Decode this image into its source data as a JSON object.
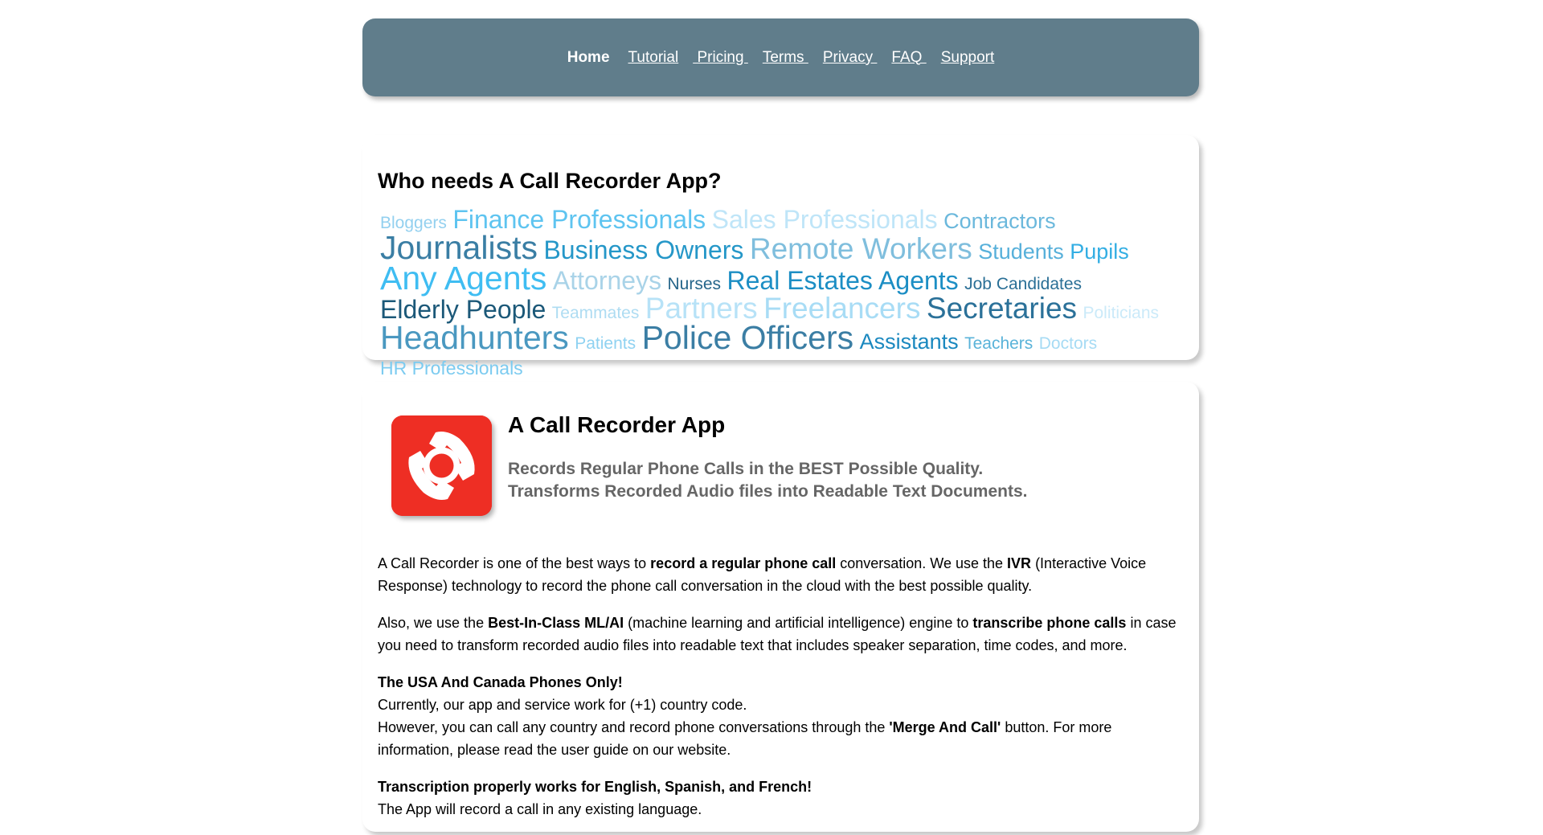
{
  "nav": {
    "items": [
      {
        "label": "Home",
        "active": true
      },
      {
        "label": "Tutorial",
        "active": false
      },
      {
        "label": " Pricing ",
        "active": false
      },
      {
        "label": "Terms ",
        "active": false
      },
      {
        "label": "Privacy ",
        "active": false
      },
      {
        "label": "FAQ ",
        "active": false
      },
      {
        "label": "Support",
        "active": false
      }
    ]
  },
  "who_needs": {
    "title": "Who needs A Call Recorder App?",
    "words": [
      {
        "text": "Bloggers",
        "size": "sm",
        "color": "#93d0ef"
      },
      {
        "text": "Finance Professionals",
        "size": "lg",
        "color": "#5ec4f0"
      },
      {
        "text": "Sales Professionals",
        "size": "lg",
        "color": "#bfe5f8"
      },
      {
        "text": "Contractors",
        "size": "md",
        "color": "#6bb8dc"
      },
      {
        "text": "Journalists",
        "size": "xxl",
        "color": "#3a7ea4"
      },
      {
        "text": "Business Owners",
        "size": "lg",
        "color": "#2597c8"
      },
      {
        "text": "Remote Workers",
        "size": "xl",
        "color": "#7fbedd"
      },
      {
        "text": "Students",
        "size": "md",
        "color": "#57b0da"
      },
      {
        "text": "Pupils",
        "size": "md",
        "color": "#33aee3"
      },
      {
        "text": "Any Agents",
        "size": "xxl",
        "color": "#3fbdf2"
      },
      {
        "text": "Attorneys",
        "size": "lg",
        "color": "#a9d3e8"
      },
      {
        "text": "Nurses",
        "size": "sm",
        "color": "#25658a"
      },
      {
        "text": "Real Estates Agents",
        "size": "lg",
        "color": "#1c8ec4"
      },
      {
        "text": "Job Candidates",
        "size": "sm",
        "color": "#2a6f96"
      },
      {
        "text": "Elderly People",
        "size": "lg",
        "color": "#1b5878"
      },
      {
        "text": "Teammates",
        "size": "sm",
        "color": "#aedcf2"
      },
      {
        "text": "Partners",
        "size": "xl",
        "color": "#b7e2f7"
      },
      {
        "text": "Freelancers",
        "size": "xl",
        "color": "#a8dcf5"
      },
      {
        "text": "Secretaries",
        "size": "xl",
        "color": "#2b7199"
      },
      {
        "text": "Politicians",
        "size": "sm",
        "color": "#cbeaf9"
      },
      {
        "text": "Headhunters",
        "size": "xxl",
        "color": "#4a98c0"
      },
      {
        "text": "Patients",
        "size": "sm",
        "color": "#8fd2f1"
      },
      {
        "text": "Police Officers",
        "size": "xxl",
        "color": "#3b7ea4"
      },
      {
        "text": "Assistants",
        "size": "md",
        "color": "#1a88bf"
      },
      {
        "text": "Teachers",
        "size": "sm",
        "color": "#5ab3d9"
      },
      {
        "text": "Doctors",
        "size": "sm",
        "color": "#a6dbf4"
      },
      {
        "text": "HR Professionals",
        "size": "smd",
        "color": "#7ccbf0"
      }
    ]
  },
  "app": {
    "title": "A Call Recorder App",
    "subtitle_1": "Records Regular Phone Calls in the BEST Possible Quality.",
    "subtitle_2": "Transforms Recorded Audio files into Readable Text Documents.",
    "icon": "call-recorder-app-icon",
    "icon_color": "#ee2e24"
  },
  "body": {
    "p1": {
      "a": "A Call Recorder is one of the best ways to ",
      "b": "record a regular phone call",
      "c": " conversation. We use the ",
      "d": "IVR",
      "e": " (Interactive Voice Response) technology to record the phone call conversation in the cloud with the best possible quality."
    },
    "p2": {
      "a": "Also, we use the ",
      "b": "Best-In-Class ML/AI",
      "c": " (machine learning and artificial intelligence) engine to ",
      "d": "transcribe phone calls",
      "e": " in case you need to transform recorded audio files into readable text that includes speaker separation, time codes, and more."
    },
    "p3": {
      "heading": "The USA And Canada Phones Only!",
      "line1": "Currently, our app and service work for (+1) country code.",
      "line2a": "However, you can call any country and record phone conversations through the ",
      "line2b": "'Merge And Call'",
      "line2c": " button. For more information, please read the user guide on our website."
    },
    "p4": {
      "heading": "Transcription properly works for English, Spanish, and French!",
      "line1": "The App will record a call in any existing language."
    }
  }
}
